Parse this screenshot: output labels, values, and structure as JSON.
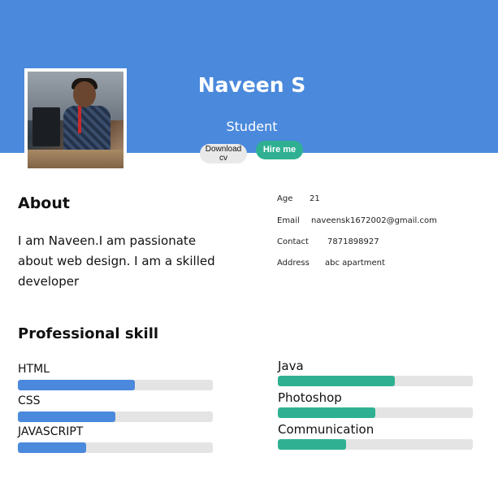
{
  "colors": {
    "banner": "#4a89dc",
    "accent_blue": "#4a89dc",
    "accent_green": "#2fb092"
  },
  "header": {
    "name": "Naveen S",
    "role": "Student",
    "download_label": "Download\ncv",
    "hire_label": "Hire me",
    "avatar_icon": "profile-photo"
  },
  "about": {
    "title": "About",
    "text": "I am Naveen.I am passionate about web design. I am a skilled developer"
  },
  "info": [
    {
      "key": "Age",
      "value": "21"
    },
    {
      "key": "Email",
      "value": "naveensk1672002@gmail.com"
    },
    {
      "key": "Contact",
      "value": "7871898927"
    },
    {
      "key": "Address",
      "value": "abc apartment"
    }
  ],
  "skills": {
    "title": "Professional skill",
    "left": [
      {
        "label": "HTML",
        "level": 0.6
      },
      {
        "label": "CSS",
        "level": 0.5
      },
      {
        "label": "JAVASCRIPT",
        "level": 0.35
      }
    ],
    "right": [
      {
        "label": "Java",
        "level": 0.6
      },
      {
        "label": "Photoshop",
        "level": 0.5
      },
      {
        "label": "Communication",
        "level": 0.35
      }
    ]
  }
}
